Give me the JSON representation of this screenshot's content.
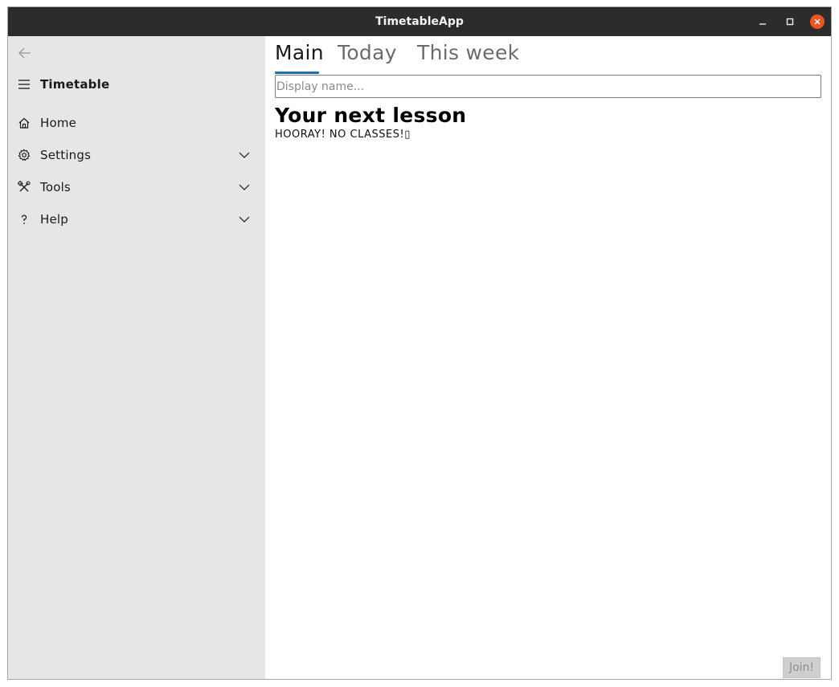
{
  "window": {
    "title": "TimetableApp"
  },
  "sidebar": {
    "header_label": "Timetable",
    "items": [
      {
        "label": "Home",
        "icon": "home-icon",
        "expandable": false
      },
      {
        "label": "Settings",
        "icon": "gear-icon",
        "expandable": true
      },
      {
        "label": "Tools",
        "icon": "tools-icon",
        "expandable": true
      },
      {
        "label": "Help",
        "icon": "help-icon",
        "expandable": true
      }
    ]
  },
  "tabs": [
    {
      "label": "Main",
      "active": true
    },
    {
      "label": "Today",
      "active": false
    },
    {
      "label": "This week",
      "active": false
    }
  ],
  "main": {
    "display_name_placeholder": "Display name...",
    "display_name_value": "",
    "heading": "Your next lesson",
    "message": "HOORAY! NO CLASSES!▯",
    "join_label": "Join!"
  },
  "colors": {
    "titlebar": "#2c2c2c",
    "sidebar": "#e6e6e6",
    "accent": "#1a6fb0",
    "close": "#e95420"
  }
}
